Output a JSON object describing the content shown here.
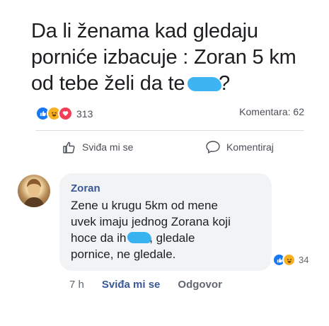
{
  "post": {
    "line1": "Da li ženama kad gledaju",
    "line2": "porniće izbacuje : Zoran 5 km",
    "line3_before": "od tebe želi da te ",
    "line3_after": "?"
  },
  "stats": {
    "reactions_count": "313",
    "comments_label": "Komentara: 62"
  },
  "actions": {
    "like_label": "Sviđa mi se",
    "comment_label": "Komentiraj"
  },
  "comment": {
    "author": "Zoran",
    "line1": "Zene u krugu 5km od mene",
    "line2": "uvek imaju jednog Zorana koji",
    "line3_before": "hoce da ih ",
    "line3_after": ", gledale",
    "line4": "pornice, ne gledale.",
    "reactions_count": "34",
    "time": "7 h",
    "like_link": "Sviđa mi se",
    "reply_link": "Odgovor"
  },
  "colors": {
    "censor": "#3fb4f2",
    "like_blue": "#1877f2",
    "link_blue": "#385898"
  }
}
